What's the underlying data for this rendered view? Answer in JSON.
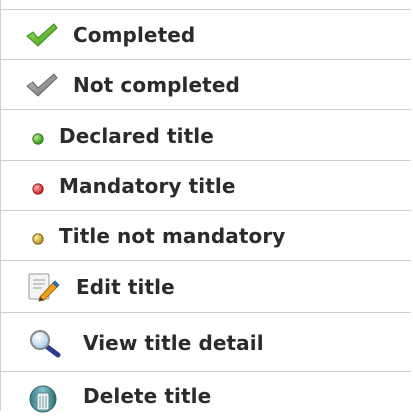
{
  "legend": {
    "items": [
      {
        "label": "Completed",
        "icon": "green-checkmark-icon"
      },
      {
        "label": "Not completed",
        "icon": "grey-checkmark-icon"
      },
      {
        "label": "Declared title",
        "icon": "green-dot-icon"
      },
      {
        "label": "Mandatory title",
        "icon": "red-dot-icon"
      },
      {
        "label": "Title not mandatory",
        "icon": "yellow-dot-icon"
      },
      {
        "label": "Edit title",
        "icon": "edit-document-icon"
      },
      {
        "label": "View title detail",
        "icon": "magnifier-icon"
      },
      {
        "label": "Delete title",
        "icon": "trash-bin-icon"
      }
    ],
    "colors": {
      "green": "#5cb531",
      "grey": "#8a8a8a",
      "red": "#d9242a",
      "yellow": "#c9a21a",
      "divider": "#cfcfcf",
      "text": "#2b2b2b"
    }
  }
}
